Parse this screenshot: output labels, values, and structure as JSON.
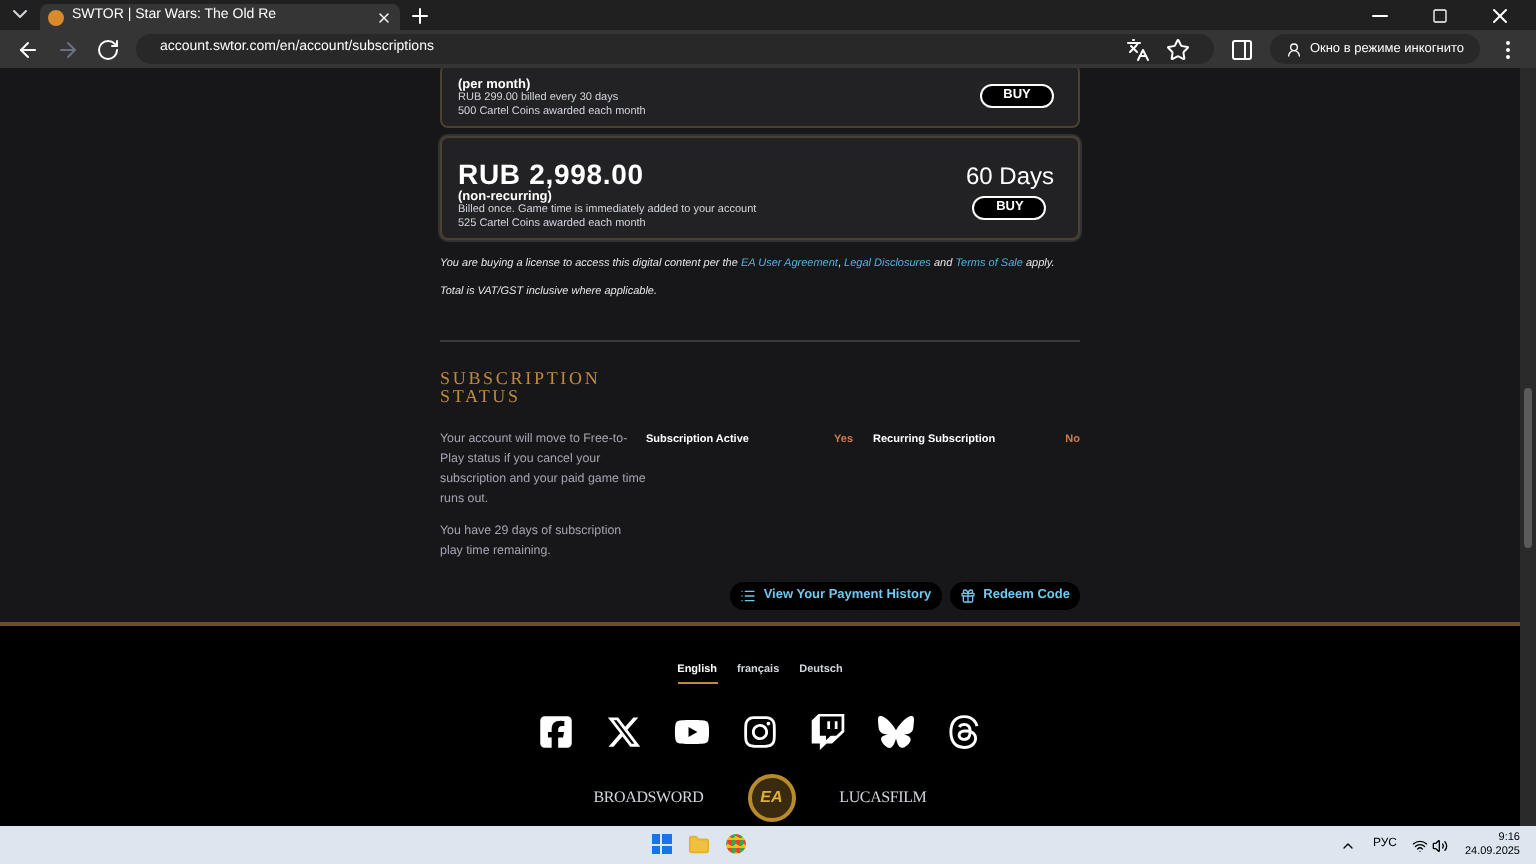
{
  "browser": {
    "tab_title": "SWTOR | Star Wars: The Old Re",
    "url": "account.swtor.com/en/account/subscriptions",
    "incognito_label": "Окно в режиме инкогнито"
  },
  "plans": [
    {
      "period": "(per month)",
      "lines": [
        "RUB 299.00 billed every 30 days",
        "500 Cartel Coins awarded each month"
      ],
      "button": "BUY"
    },
    {
      "price": "RUB 2,998.00",
      "period": "(non-recurring)",
      "lines": [
        "Billed once. Game time is immediately added to your account",
        "525 Cartel Coins awarded each month"
      ],
      "duration": "60 Days",
      "button": "BUY"
    }
  ],
  "legal": {
    "before": "You are buying a license to access this digital content per the",
    "link1": "EA User Agreement",
    "sep": ",",
    "link2": "Legal Disclosures",
    "and": "and",
    "link3": "Terms of Sale",
    "after": "apply.",
    "vat": "Total is VAT/GST inclusive where applicable."
  },
  "status": {
    "title": "SUBSCRIPTION STATUS",
    "note": "Your account will move to Free-to-Play status if you cancel your subscription and your paid game time runs out.",
    "remaining": "You have 29 days of subscription play time remaining.",
    "items": [
      {
        "label": "Subscription Active",
        "value": "Yes"
      },
      {
        "label": "Recurring Subscription",
        "value": "No"
      }
    ],
    "buttons": [
      "View Your Payment History",
      "Redeem Code"
    ]
  },
  "footer": {
    "languages": [
      {
        "label": "English",
        "selected": true
      },
      {
        "label": "français",
        "selected": false
      },
      {
        "label": "Deutsch",
        "selected": false
      }
    ],
    "logos": [
      "BROADSWORD",
      "EA",
      "LUCASFILM"
    ]
  },
  "taskbar": {
    "lang": "РУС",
    "time": "9:16",
    "date": "24.09.2025"
  }
}
